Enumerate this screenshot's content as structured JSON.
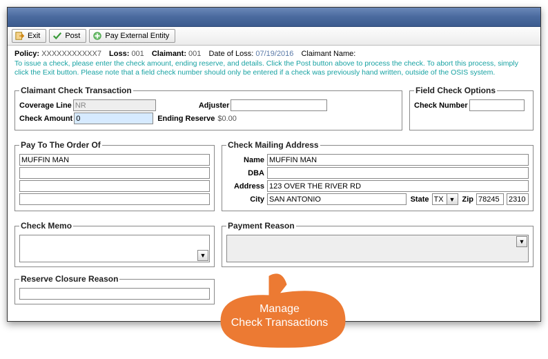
{
  "toolbar": {
    "exit_label": "Exit",
    "post_label": "Post",
    "pay_external_label": "Pay External Entity"
  },
  "info": {
    "policy_label": "Policy:",
    "policy_value": "XXXXXXXXXXX7",
    "loss_label": "Loss:",
    "loss_value": "001",
    "claimant_label": "Claimant:",
    "claimant_value": "001",
    "dol_label": "Date of Loss:",
    "dol_value": "07/19/2016",
    "claimant_name_label": "Claimant Name:"
  },
  "help_text": "To issue a check, please enter the check amount, ending reserve, and details. Click the Post button above to process the check. To abort this process, simply click the Exit button. Please note that a field check number should only be entered if a check was previously hand written, outside of the OSIS system.",
  "sections": {
    "claimant_check": "Claimant Check Transaction",
    "field_check": "Field Check Options",
    "pay_to": "Pay To The Order Of",
    "mailing": "Check Mailing Address",
    "memo": "Check Memo",
    "payment_reason": "Payment Reason",
    "reserve_closure": "Reserve Closure Reason"
  },
  "fields": {
    "coverage_line_label": "Coverage Line",
    "coverage_line_value": "NR",
    "adjuster_label": "Adjuster",
    "adjuster_value": "",
    "check_amount_label": "Check Amount",
    "check_amount_value": "0",
    "ending_reserve_label": "Ending Reserve",
    "ending_reserve_value": "$0.00",
    "check_number_label": "Check Number",
    "check_number_value": "",
    "payto_line1": "MUFFIN MAN",
    "payto_line2": "",
    "payto_line3": "",
    "payto_line4": "",
    "name_label": "Name",
    "name_value": "MUFFIN MAN",
    "dba_label": "DBA",
    "dba_value": "",
    "address_label": "Address",
    "address_value": "123 OVER THE RIVER RD",
    "city_label": "City",
    "city_value": "SAN ANTONIO",
    "state_label": "State",
    "state_value": "TX",
    "zip_label": "Zip",
    "zip_value": "78245",
    "zip4_value": "2310",
    "memo_value": "",
    "payment_reason_value": "",
    "reserve_closure_value": ""
  },
  "callout": {
    "line1": "Manage",
    "line2": "Check Transactions"
  }
}
